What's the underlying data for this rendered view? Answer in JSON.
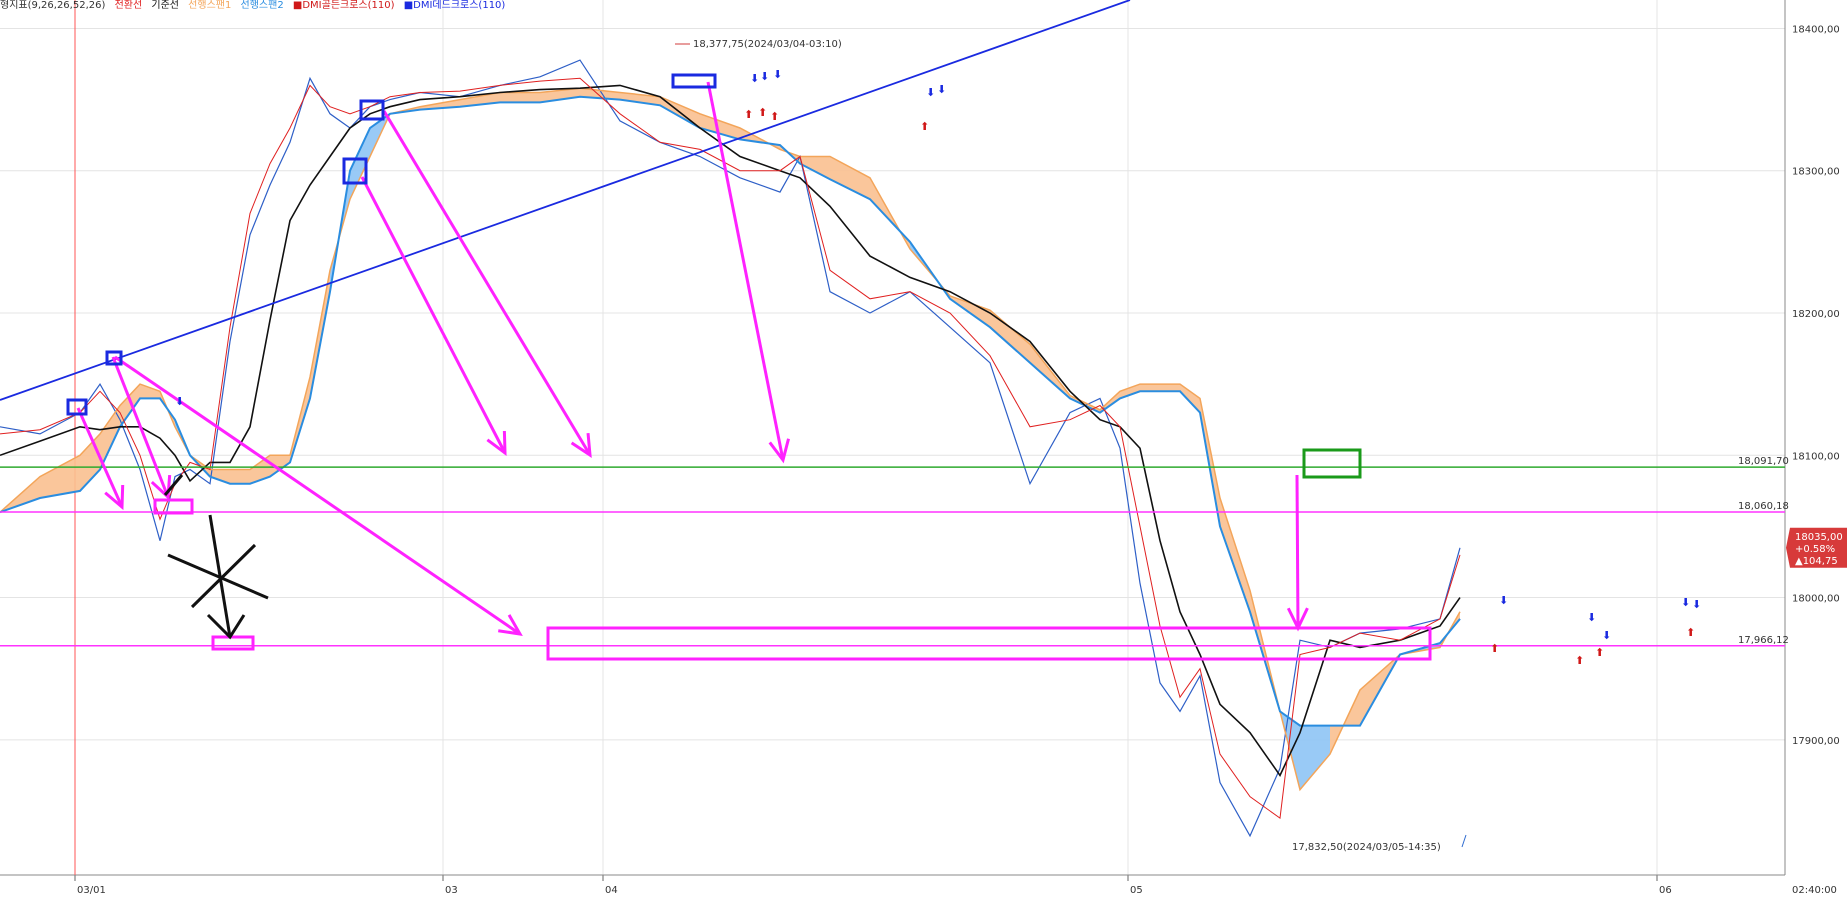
{
  "legend": {
    "label": "형지표(9,26,26,52,26)",
    "items": [
      {
        "text": "전환선",
        "color": "#e02020"
      },
      {
        "text": "기준선",
        "color": "#111111"
      },
      {
        "text": "선행스팬1",
        "color": "#f3a55a"
      },
      {
        "text": "선행스팬2",
        "color": "#2a8de0"
      },
      {
        "text": "■DMI골든크로스(110)",
        "color": "#d01818"
      },
      {
        "text": "■DMI데드크로스(110)",
        "color": "#1a2ae0"
      }
    ]
  },
  "price_tag": {
    "price": "18035,00",
    "pct": "+0.58%",
    "change": "▲104,75",
    "color": "#d73a3a"
  },
  "annotations": {
    "high_label": "18,377,75(2024/03/04-03:10)",
    "low_label": "17,832,50(2024/03/05-14:35)"
  },
  "chart_data": {
    "type": "line",
    "title": "",
    "xlabel": "",
    "ylabel": "",
    "ylim": [
      17805,
      18420
    ],
    "yticks": [
      17900,
      18000,
      18100,
      18200,
      18300,
      18400
    ],
    "ytick_labels": [
      "17900,00",
      "18000,00",
      "18100,00",
      "18200,00",
      "18300,00",
      "18400,00"
    ],
    "xticks": [
      "03/01",
      "03",
      "04",
      "05",
      "06"
    ],
    "time_label": "02:40:00",
    "levels": [
      {
        "value": 18091.7,
        "label": "18,091,70",
        "color": "#2eaa2e"
      },
      {
        "value": 18060.18,
        "label": "18,060,18",
        "color": "#ff33ff"
      },
      {
        "value": 17966.12,
        "label": "17,966,12",
        "color": "#ff33ff"
      }
    ],
    "colors": {
      "conversion": "#e02020",
      "base": "#111111",
      "span1": "#f3a55a",
      "span2": "#2a8de0",
      "price": "#2e5fc7",
      "trendline": "#1a2ae0",
      "drawing": "#ff22ff",
      "vline": "#ff5555",
      "grid": "#e4e4e4"
    },
    "x": [
      0,
      40,
      80,
      100,
      120,
      140,
      160,
      175,
      190,
      210,
      230,
      250,
      270,
      290,
      310,
      330,
      350,
      370,
      390,
      420,
      460,
      500,
      540,
      580,
      620,
      660,
      700,
      740,
      780,
      800,
      830,
      870,
      910,
      950,
      990,
      1030,
      1070,
      1100,
      1120,
      1140,
      1160,
      1180,
      1200,
      1220,
      1250,
      1280,
      1300,
      1330,
      1360,
      1400,
      1440,
      1460
    ],
    "series": [
      {
        "name": "선행스팬1",
        "role": "span1",
        "values": [
          18060,
          18085,
          18100,
          18115,
          18135,
          18150,
          18145,
          18120,
          18100,
          18090,
          18090,
          18090,
          18100,
          18100,
          18155,
          18230,
          18280,
          18310,
          18340,
          18345,
          18350,
          18355,
          18355,
          18358,
          18355,
          18352,
          18340,
          18330,
          18315,
          18310,
          18310,
          18295,
          18245,
          18212,
          18202,
          18178,
          18142,
          18132,
          18145,
          18150,
          18150,
          18150,
          18140,
          18070,
          18005,
          17920,
          17865,
          17890,
          17935,
          17960,
          17965,
          17990
        ]
      },
      {
        "name": "선행스팬2",
        "role": "span2",
        "values": [
          18060,
          18070,
          18075,
          18090,
          18120,
          18140,
          18140,
          18125,
          18100,
          18085,
          18080,
          18080,
          18085,
          18095,
          18140,
          18215,
          18300,
          18330,
          18340,
          18343,
          18345,
          18348,
          18348,
          18352,
          18350,
          18346,
          18330,
          18322,
          18318,
          18305,
          18294,
          18280,
          18250,
          18210,
          18190,
          18165,
          18140,
          18130,
          18140,
          18145,
          18145,
          18145,
          18130,
          18050,
          17990,
          17920,
          17910,
          17910,
          17910,
          17960,
          17968,
          17985
        ]
      },
      {
        "name": "기준선",
        "role": "base",
        "values": [
          18100,
          18110,
          18120,
          18118,
          18120,
          18120,
          18112,
          18100,
          18082,
          18095,
          18095,
          18120,
          18195,
          18265,
          18290,
          18310,
          18330,
          18340,
          18345,
          18350,
          18352,
          18355,
          18357,
          18358,
          18360,
          18352,
          18330,
          18310,
          18300,
          18295,
          18275,
          18240,
          18225,
          18215,
          18200,
          18180,
          18145,
          18125,
          18120,
          18105,
          18040,
          17990,
          17960,
          17925,
          17905,
          17875,
          17905,
          17970,
          17965,
          17970,
          17980,
          18000
        ]
      },
      {
        "name": "전환선",
        "role": "conversion",
        "values": [
          18115,
          18118,
          18130,
          18145,
          18130,
          18100,
          18055,
          18080,
          18095,
          18090,
          18190,
          18270,
          18305,
          18330,
          18360,
          18345,
          18340,
          18345,
          18352,
          18355,
          18356,
          18360,
          18363,
          18365,
          18340,
          18320,
          18315,
          18300,
          18300,
          18310,
          18230,
          18210,
          18215,
          18200,
          18170,
          18120,
          18125,
          18135,
          18120,
          18050,
          17980,
          17930,
          17950,
          17890,
          17860,
          17845,
          17960,
          17965,
          17975,
          17970,
          17985,
          18030
        ]
      },
      {
        "name": "price",
        "role": "price",
        "values": [
          18120,
          18115,
          18130,
          18150,
          18125,
          18090,
          18040,
          18085,
          18090,
          18080,
          18180,
          18255,
          18290,
          18320,
          18365,
          18340,
          18330,
          18345,
          18350,
          18355,
          18352,
          18360,
          18366,
          18377.75,
          18335,
          18320,
          18310,
          18295,
          18285,
          18310,
          18215,
          18200,
          18215,
          18190,
          18165,
          18080,
          18130,
          18140,
          18105,
          18010,
          17940,
          17920,
          17945,
          17870,
          17832.5,
          17880,
          17970,
          17965,
          17975,
          17978,
          17985,
          18035
        ]
      }
    ]
  }
}
